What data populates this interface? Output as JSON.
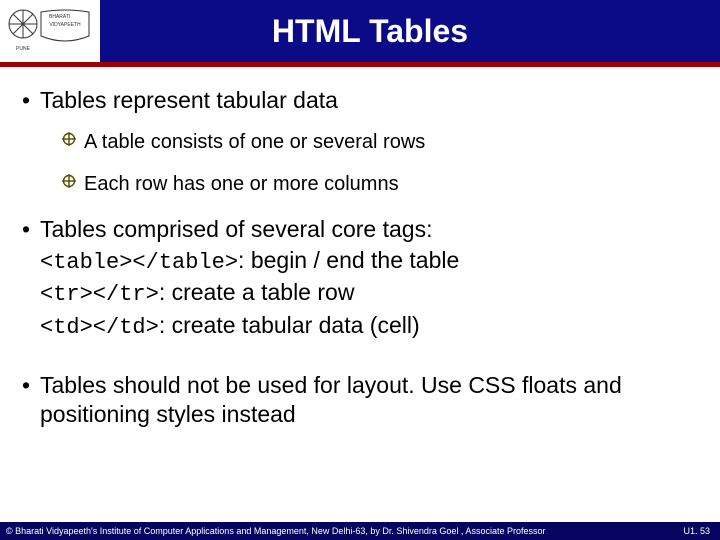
{
  "header": {
    "title": "HTML Tables",
    "logo_alt": "Bharati Vidyapeeth logo"
  },
  "bullets": {
    "b1": "Tables represent tabular data",
    "b1_sub1": "A table consists of one or several rows",
    "b1_sub2": "Each row has one or more columns",
    "b2_intro": "Tables comprised of several core tags:",
    "b2_l1_code": "<table></table>",
    "b2_l1_rest": ": begin / end the table",
    "b2_l2_code": "<tr></tr>",
    "b2_l2_rest": ": create a table row",
    "b2_l3_code": "<td></td>",
    "b2_l3_rest": ": create tabular data (cell)",
    "b3": "Tables should not be used for layout. Use CSS floats and positioning styles instead"
  },
  "footer": {
    "copyright": "© Bharati Vidyapeeth's Institute of Computer Applications and Management, New Delhi-63, by Dr. Shivendra Goel , Associate Professor",
    "page": "U1. 53"
  }
}
